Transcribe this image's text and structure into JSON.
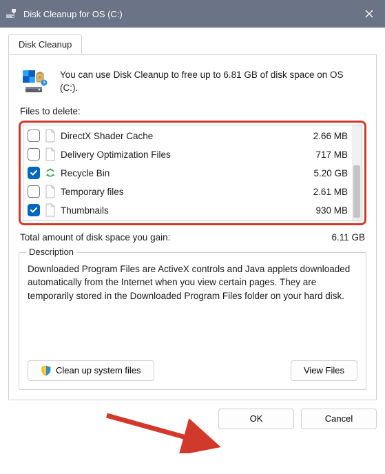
{
  "titlebar": {
    "title": "Disk Cleanup for OS (C:)"
  },
  "tab": {
    "label": "Disk Cleanup"
  },
  "intro": {
    "text": "You can use Disk Cleanup to free up to 6.81 GB of disk space on OS (C:)."
  },
  "files_label": "Files to delete:",
  "files": [
    {
      "name": "DirectX Shader Cache",
      "size": "2.66 MB",
      "checked": false,
      "icon": "page"
    },
    {
      "name": "Delivery Optimization Files",
      "size": "717 MB",
      "checked": false,
      "icon": "page"
    },
    {
      "name": "Recycle Bin",
      "size": "5.20 GB",
      "checked": true,
      "icon": "recycle"
    },
    {
      "name": "Temporary files",
      "size": "2.61 MB",
      "checked": false,
      "icon": "page"
    },
    {
      "name": "Thumbnails",
      "size": "930 MB",
      "checked": true,
      "icon": "page"
    }
  ],
  "total": {
    "label": "Total amount of disk space you gain:",
    "value": "6.11 GB"
  },
  "description": {
    "title": "Description",
    "text": "Downloaded Program Files are ActiveX controls and Java applets downloaded automatically from the Internet when you view certain pages. They are temporarily stored in the Downloaded Program Files folder on your hard disk."
  },
  "buttons": {
    "cleanup_system": "Clean up system files",
    "view_files": "View Files",
    "ok": "OK",
    "cancel": "Cancel"
  }
}
